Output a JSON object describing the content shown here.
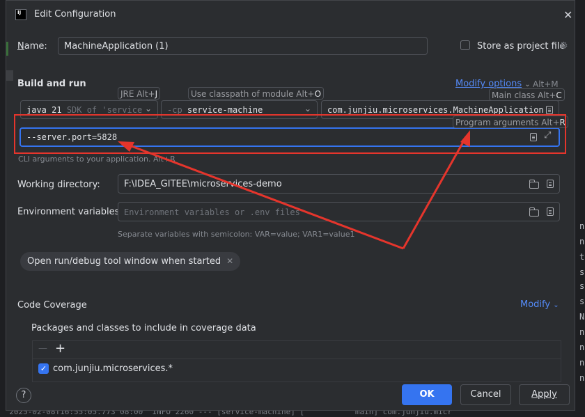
{
  "window": {
    "title": "Edit Configuration",
    "logo_text": "IJ"
  },
  "name": {
    "label": "Name:",
    "value": "MachineApplication (1)"
  },
  "store": {
    "label": "Store as project file"
  },
  "build_run": {
    "heading": "Build and run",
    "modify_options": "Modify options",
    "modify_shortcut": "Alt+M",
    "jre_hint_text": "JRE Alt+",
    "jre_hint_key": "J",
    "classpath_hint_text": "Use classpath of module Alt+",
    "classpath_hint_key": "O",
    "mainclass_hint_text": "Main class Alt+",
    "mainclass_hint_key": "C",
    "progargs_hint_text": "Program arguments Alt+",
    "progargs_hint_key": "R",
    "jre_value": "java 21",
    "jre_sdk": "SDK of 'service",
    "cp_prefix": "-cp",
    "cp_value": "service-machine",
    "main_class": "com.junjiu.microservices.MachineApplication",
    "program_args": "--server.port=5828",
    "cli_hint": "CLI arguments to your application. Alt+R"
  },
  "working_dir": {
    "label": "Working directory:",
    "value": "F:\\IDEA_GITEE\\microservices-demo"
  },
  "env_vars": {
    "label": "Environment variables:",
    "placeholder": "Environment variables or .env files",
    "hint": "Separate variables with semicolon: VAR=value; VAR1=value1"
  },
  "chip": {
    "label": "Open run/debug tool window when started",
    "close": "✕"
  },
  "coverage": {
    "heading": "Code Coverage",
    "modify": "Modify",
    "packages_label": "Packages and classes to include in coverage data",
    "remove_glyph": "—",
    "add_glyph": "+",
    "item": "com.junjiu.microservices.*"
  },
  "buttons": {
    "ok": "OK",
    "cancel": "Cancel",
    "apply": "Apply",
    "help": "?"
  },
  "background": {
    "right_chars": [
      "n",
      "n",
      "t",
      "s",
      "s",
      "s",
      "N",
      "n",
      "n",
      "n",
      "n"
    ],
    "bottom_text": "  2025-02-08T16:55:05.773 08:00  INFO 2260 --- [service-machine] [           main] com.junjiu.micr"
  },
  "colors": {
    "accent": "#3574f0",
    "annotation": "#e5352c",
    "dialog_bg": "#2b2d30"
  }
}
